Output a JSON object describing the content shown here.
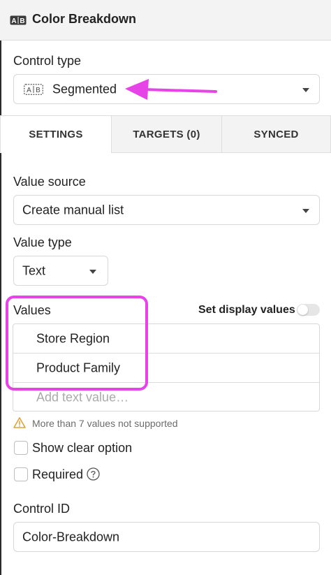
{
  "header": {
    "title": "Color Breakdown",
    "icon": "segmented-control-icon"
  },
  "control_type": {
    "label": "Control type",
    "value": "Segmented",
    "icon": "segmented-control-icon"
  },
  "annotation": {
    "color": "#e744e8"
  },
  "tabs": [
    {
      "label": "SETTINGS",
      "active": true
    },
    {
      "label": "TARGETS (0)",
      "active": false
    },
    {
      "label": "SYNCED",
      "active": false
    }
  ],
  "value_source": {
    "label": "Value source",
    "value": "Create manual list"
  },
  "value_type": {
    "label": "Value type",
    "value": "Text"
  },
  "values": {
    "label": "Values",
    "display_values_label": "Set display values",
    "display_values_enabled": false,
    "items": [
      "Store Region",
      "Product Family"
    ],
    "placeholder": "Add text value…"
  },
  "warning": {
    "text": "More than 7 values not supported",
    "color": "#e0a33a"
  },
  "options": {
    "show_clear_label": "Show clear option",
    "show_clear_checked": false,
    "required_label": "Required",
    "required_checked": false
  },
  "control_id": {
    "label": "Control ID",
    "value": "Color-Breakdown"
  }
}
